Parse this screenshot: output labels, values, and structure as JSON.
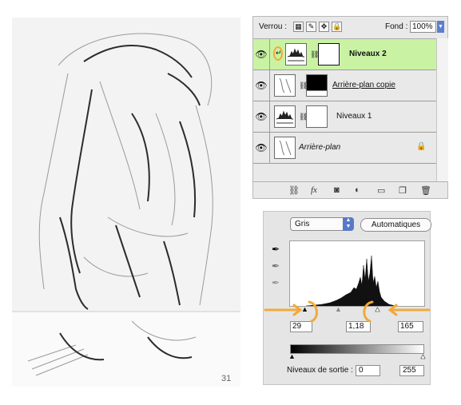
{
  "layers_panel": {
    "lock_label": "Verrou :",
    "opacity_label": "Fond :",
    "opacity_value": "100%",
    "layers": [
      {
        "name": "Niveaux 2",
        "selected": true
      },
      {
        "name": "Arrière-plan copie",
        "selected": false
      },
      {
        "name": "Niveaux 1",
        "selected": false
      },
      {
        "name": "Arrière-plan",
        "selected": false
      }
    ]
  },
  "levels_panel": {
    "channel": "Gris",
    "auto_button": "Automatiques",
    "input_black": "29",
    "input_gamma": "1,18",
    "input_white": "165",
    "output_label": "Niveaux de sortie :",
    "output_black": "0",
    "output_white": "255",
    "accent_color": "#f2a93a"
  },
  "drawing": {
    "page_number": "31"
  }
}
